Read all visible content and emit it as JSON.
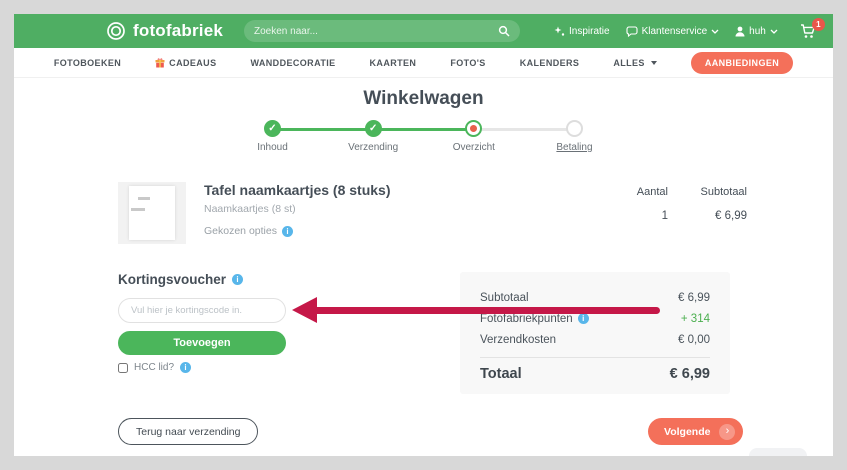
{
  "colors": {
    "brand_green": "#4fae63",
    "button_green": "#4bb65b",
    "accent_coral": "#f4705a",
    "arrow_red": "#c51848",
    "points_green": "#4caf50",
    "info_blue": "#58b6ea",
    "badge_red": "#e8574a"
  },
  "header": {
    "logo": "fotofabriek",
    "search_placeholder": "Zoeken naar...",
    "inspiratie": "Inspiratie",
    "klantenservice": "Klantenservice",
    "account": "huh",
    "cart_count": "1"
  },
  "nav": {
    "items": [
      "FOTOBOEKEN",
      "CADEAUS",
      "WANDDECORATIE",
      "KAARTEN",
      "FOTO'S",
      "KALENDERS",
      "ALLES"
    ],
    "sale": "AANBIEDINGEN"
  },
  "title": "Winkelwagen",
  "stepper": {
    "steps": [
      {
        "label": "Inhoud",
        "state": "done"
      },
      {
        "label": "Verzending",
        "state": "done"
      },
      {
        "label": "Overzicht",
        "state": "current"
      },
      {
        "label": "Betaling",
        "state": "todo"
      }
    ]
  },
  "cart": {
    "item_title": "Tafel naamkaartjes (8 stuks)",
    "item_subtitle": "Naamkaartjes (8 st)",
    "options_label": "Gekozen opties",
    "qty_header": "Aantal",
    "subtotal_header": "Subtotaal",
    "qty": "1",
    "subtotal": "€ 6,99"
  },
  "voucher": {
    "title": "Kortingsvoucher",
    "placeholder": "Vul hier je kortingscode in.",
    "submit": "Toevoegen",
    "hcc_label": "HCC lid?"
  },
  "summary": {
    "rows": [
      {
        "label": "Subtotaal",
        "value": "€ 6,99"
      },
      {
        "label": "Fotofabriekpunten",
        "value": "+ 314"
      },
      {
        "label": "Verzendkosten",
        "value": "€ 0,00"
      }
    ],
    "total_label": "Totaal",
    "total_value": "€ 6,99"
  },
  "footer": {
    "back": "Terug naar verzending",
    "next": "Volgende"
  }
}
